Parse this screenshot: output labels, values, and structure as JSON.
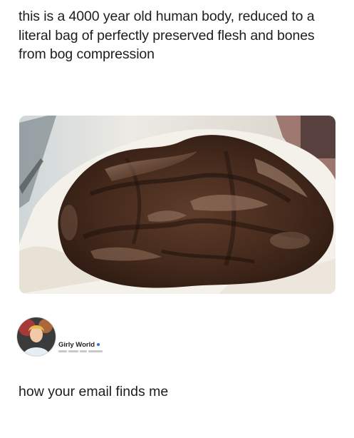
{
  "post": {
    "text": "this is a 4000 year old human body, reduced to a literal bag of perfectly preserved flesh and bones from bog compression"
  },
  "account": {
    "name": "Girly World"
  },
  "caption": {
    "text": "how your email finds me"
  },
  "colors": {
    "background": "#ffffff",
    "text": "#1d1d1d",
    "flesh_dark": "#3b2418",
    "flesh_mid": "#5a3a28",
    "flesh_highlight": "#a58470",
    "cloth": "#f1ede6",
    "verified": "#2f6fe0"
  }
}
